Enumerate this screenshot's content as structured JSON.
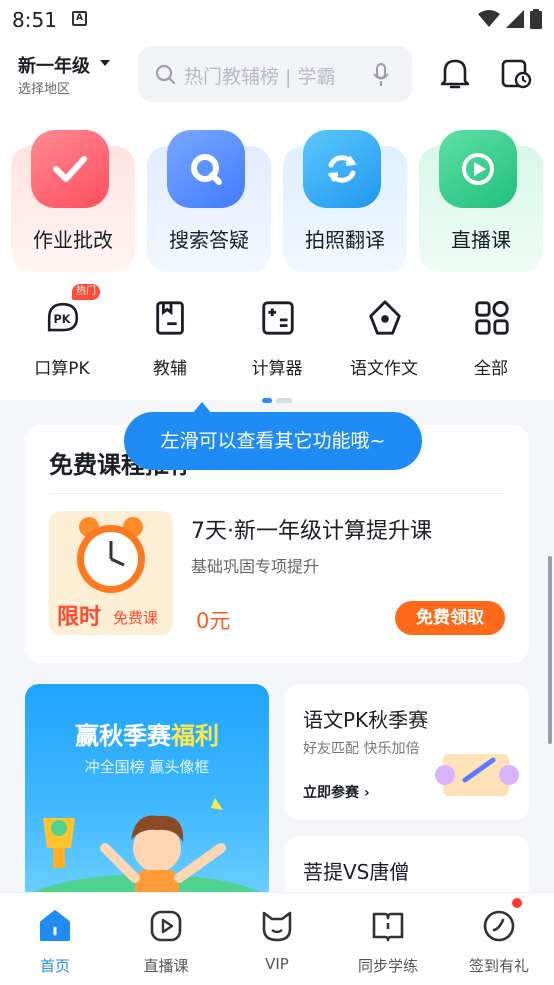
{
  "status_bar": {
    "time": "8:51"
  },
  "header": {
    "grade": "新一年级",
    "region": "选择地区",
    "search_placeholder": "热门教辅榜 | 学霸"
  },
  "feature_cards": [
    {
      "label": "作业批改",
      "icon": "check-icon",
      "color": "#ff6b78"
    },
    {
      "label": "搜索答疑",
      "icon": "search-q-icon",
      "color": "#4b8dff"
    },
    {
      "label": "拍照翻译",
      "icon": "refresh-icon",
      "color": "#2aa6f5"
    },
    {
      "label": "直播课",
      "icon": "play-icon",
      "color": "#25c989"
    }
  ],
  "tools": [
    {
      "label": "口算PK",
      "icon": "pk-icon",
      "badge": "热门"
    },
    {
      "label": "教辅",
      "icon": "book-icon"
    },
    {
      "label": "计算器",
      "icon": "calculator-icon"
    },
    {
      "label": "语文作文",
      "icon": "pen-nib-icon"
    },
    {
      "label": "全部",
      "icon": "grid-icon"
    }
  ],
  "tooltip": "左滑可以查看其它功能哦~",
  "course_card": {
    "title": "免费课程推荐",
    "thumb_limit": "限时",
    "thumb_free": "免费课",
    "name": "7天·新一年级计算提升课",
    "subtitle": "基础巩固专项提升",
    "price": "0元",
    "button": "免费领取"
  },
  "banner": {
    "title_a": "赢秋季赛",
    "title_b": "福利",
    "subtitle": "冲全国榜  赢头像框"
  },
  "pk_card": {
    "title": "语文PK秋季赛",
    "subtitle": "好友匹配 快乐加倍",
    "link": "立即参赛"
  },
  "bodhi_card": {
    "title": "菩提VS唐僧"
  },
  "bottom_nav": [
    {
      "label": "首页",
      "icon": "home-icon",
      "active": true
    },
    {
      "label": "直播课",
      "icon": "live-play-icon"
    },
    {
      "label": "VIP",
      "icon": "vip-cat-icon"
    },
    {
      "label": "同步学练",
      "icon": "open-book-icon"
    },
    {
      "label": "签到有礼",
      "icon": "checkin-icon"
    }
  ],
  "colors": {
    "accent": "#1f8cf5",
    "price": "#ff5a1f",
    "button": "#ff6a1a"
  }
}
